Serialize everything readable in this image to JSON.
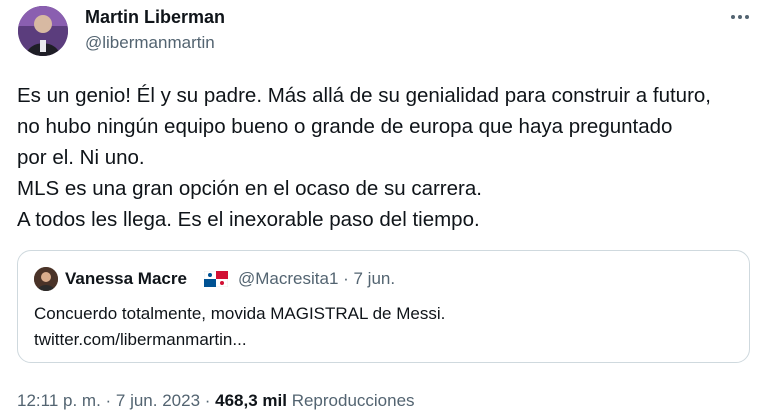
{
  "author": {
    "name": "Martin Liberman",
    "handle": "@libermanmartin"
  },
  "more_icon": "more-horizontal-icon",
  "tweet": {
    "lines": [
      "Es un genio! Él y su padre. Más allá de su genialidad para construir a futuro,",
      "no hubo ningún equipo bueno o grande de europa que haya preguntado",
      "por el. Ni uno.",
      "MLS es una gran opción en el ocaso de su carrera.",
      "A todos les llega. Es el inexorable paso del tiempo."
    ]
  },
  "quote": {
    "name": "Vanessa Macre",
    "flag_icon": "panama-flag-icon",
    "handle_date": "@Macresita1 · 7 jun.",
    "text_line1": "Concuerdo totalmente, movida MAGISTRAL de Messi.",
    "text_line2": "twitter.com/libermanmartin..."
  },
  "meta": {
    "time_date": "12:11 p. m. · 7 jun. 2023 · ",
    "views_count": "468,3 mil",
    "views_label": " Reproducciones"
  },
  "colors": {
    "text": "#0f1419",
    "secondary": "#536471",
    "border": "#cfd9de"
  }
}
